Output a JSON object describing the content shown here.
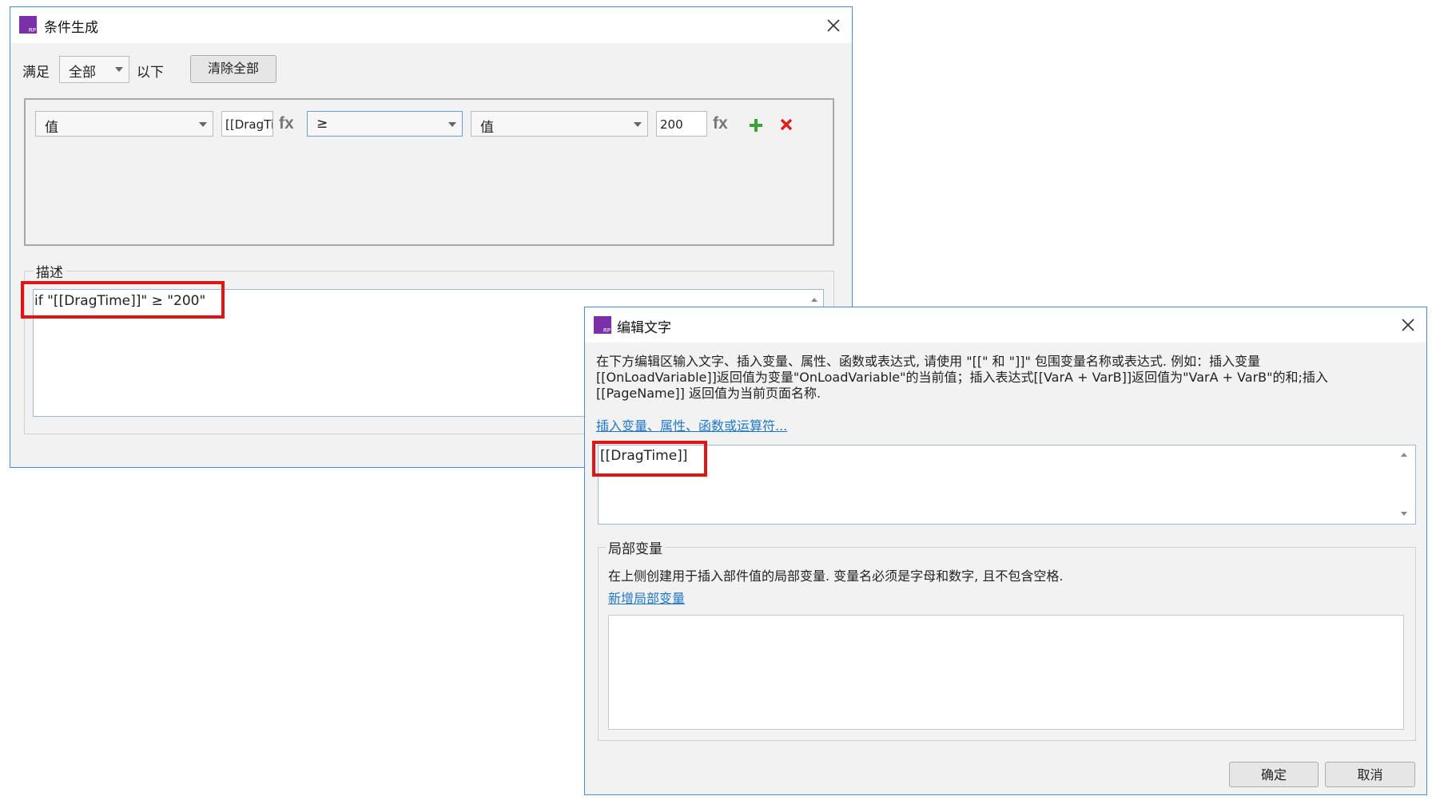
{
  "condition_dialog": {
    "title": "条件生成",
    "satisfy_label": "满足",
    "satisfy_value": "全部",
    "following_label": "以下",
    "clear_all_button": "清除全部",
    "row": {
      "left_type": "值",
      "left_value": "[[DragTi",
      "fx_left": "fx",
      "operator": "≥",
      "right_type": "值",
      "right_value": "200",
      "fx_right": "fx"
    },
    "description_label": "描述",
    "description_text": "if \"[[DragTime]]\" ≥ \"200\""
  },
  "edit_text_dialog": {
    "title": "编辑文字",
    "instructions_line1": "在下方编辑区输入文字、插入变量、属性、函数或表达式, 请使用 \"[[\" 和 \"]]\" 包围变量名称或表达式. 例如：插入变量",
    "instructions_line2": "[[OnLoadVariable]]返回值为变量\"OnLoadVariable\"的当前值；插入表达式[[VarA + VarB]]返回值为\"VarA + VarB\"的和;插入",
    "instructions_line3": "[[PageName]] 返回值为当前页面名称.",
    "insert_link": "插入变量、属性、函数或运算符...",
    "editor_text": "[[DragTime]]",
    "local_vars_label": "局部变量",
    "local_vars_desc": "在上侧创建用于插入部件值的局部变量. 变量名必须是字母和数字, 且不包含空格.",
    "add_local_var_link": "新增局部变量",
    "ok_button": "确定",
    "cancel_button": "取消"
  },
  "colors": {
    "highlight": "#e01515",
    "dialog_border": "#4a8bd4",
    "app_icon": "#7b2fa8",
    "add_icon": "#3aa336",
    "delete_icon": "#e02020",
    "link": "#1f77c8"
  }
}
